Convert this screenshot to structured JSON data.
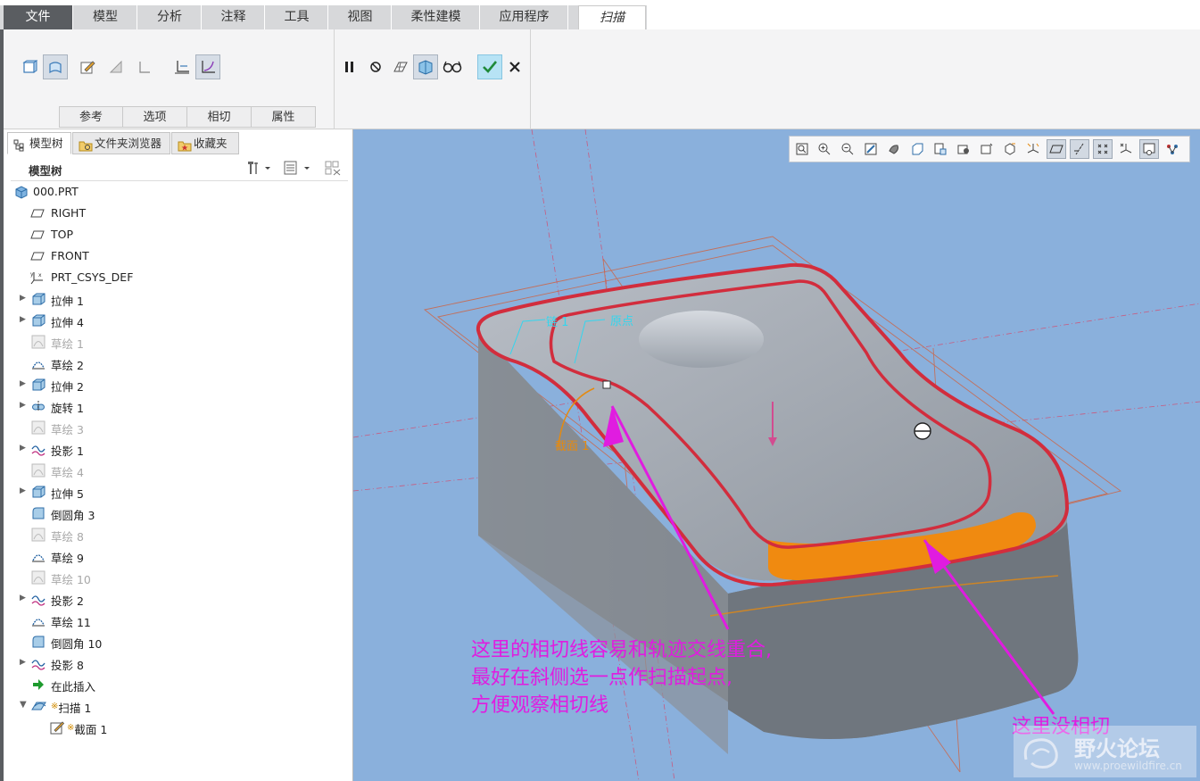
{
  "ribbon_tabs": [
    {
      "label": "文件"
    },
    {
      "label": "模型"
    },
    {
      "label": "分析"
    },
    {
      "label": "注释"
    },
    {
      "label": "工具"
    },
    {
      "label": "视图"
    },
    {
      "label": "柔性建模"
    },
    {
      "label": "应用程序"
    },
    {
      "label": "扫描"
    }
  ],
  "ribbon": {
    "subtabs": [
      "参考",
      "选项",
      "相切",
      "属性"
    ]
  },
  "panel_tabs": {
    "model_tree": "模型树",
    "folder_browser": "文件夹浏览器",
    "favorites": "收藏夹"
  },
  "tree_header": {
    "title": "模型树"
  },
  "tree": [
    {
      "label": "000.PRT",
      "icon": "part-icon",
      "dim": false,
      "expand": false
    },
    {
      "label": "RIGHT",
      "icon": "datum-plane-icon",
      "dim": false,
      "expand": false
    },
    {
      "label": "TOP",
      "icon": "datum-plane-icon",
      "dim": false,
      "expand": false
    },
    {
      "label": "FRONT",
      "icon": "datum-plane-icon",
      "dim": false,
      "expand": false
    },
    {
      "label": "PRT_CSYS_DEF",
      "icon": "csys-icon",
      "dim": false,
      "expand": false
    },
    {
      "label": "拉伸 1",
      "icon": "extrude-icon",
      "dim": false,
      "expand": true
    },
    {
      "label": "拉伸 4",
      "icon": "extrude-icon",
      "dim": false,
      "expand": true
    },
    {
      "label": "草绘 1",
      "icon": "sketch-icon",
      "dim": true,
      "expand": false
    },
    {
      "label": "草绘 2",
      "icon": "sketch-icon",
      "dim": false,
      "expand": false
    },
    {
      "label": "拉伸 2",
      "icon": "extrude-icon",
      "dim": false,
      "expand": true
    },
    {
      "label": "旋转 1",
      "icon": "revolve-icon",
      "dim": false,
      "expand": true
    },
    {
      "label": "草绘 3",
      "icon": "sketch-icon",
      "dim": true,
      "expand": false
    },
    {
      "label": "投影 1",
      "icon": "projection-icon",
      "dim": false,
      "expand": true
    },
    {
      "label": "草绘 4",
      "icon": "sketch-icon",
      "dim": true,
      "expand": false
    },
    {
      "label": "拉伸 5",
      "icon": "extrude-icon",
      "dim": false,
      "expand": true
    },
    {
      "label": "倒圆角 3",
      "icon": "round-icon",
      "dim": false,
      "expand": false
    },
    {
      "label": "草绘 8",
      "icon": "sketch-icon",
      "dim": true,
      "expand": false
    },
    {
      "label": "草绘 9",
      "icon": "sketch-icon",
      "dim": false,
      "expand": false
    },
    {
      "label": "草绘 10",
      "icon": "sketch-icon",
      "dim": true,
      "expand": false
    },
    {
      "label": "投影 2",
      "icon": "projection-icon",
      "dim": false,
      "expand": true
    },
    {
      "label": "草绘 11",
      "icon": "sketch-icon",
      "dim": false,
      "expand": false
    },
    {
      "label": "倒圆角 10",
      "icon": "round-icon",
      "dim": false,
      "expand": false
    },
    {
      "label": "投影 8",
      "icon": "projection-icon",
      "dim": false,
      "expand": true
    },
    {
      "label": "在此插入",
      "icon": "insert-here-icon",
      "dim": false,
      "expand": false
    },
    {
      "label": "扫描 1",
      "icon": "sweep-icon",
      "dim": false,
      "expand": "open"
    },
    {
      "label": "截面 1",
      "icon": "section-icon",
      "dim": false,
      "expand": false
    }
  ],
  "viewport": {
    "labels": {
      "chain": "链 1",
      "origin": "原点",
      "section": "截面 1"
    },
    "annotation_lines": [
      "这里的相切线容易和轨迹交线重合,",
      "最好在斜侧选一点作扫描起点,",
      "方便观察相切线"
    ],
    "annotation2": "这里没相切",
    "watermark": {
      "title": "野火论坛",
      "url": "www.proewildfire.cn"
    }
  },
  "colors": {
    "viewport_bg": "#8ab0dc",
    "trajectory": "#d22d3d",
    "annotation": "#e01ce0",
    "section": "#e58a10"
  }
}
